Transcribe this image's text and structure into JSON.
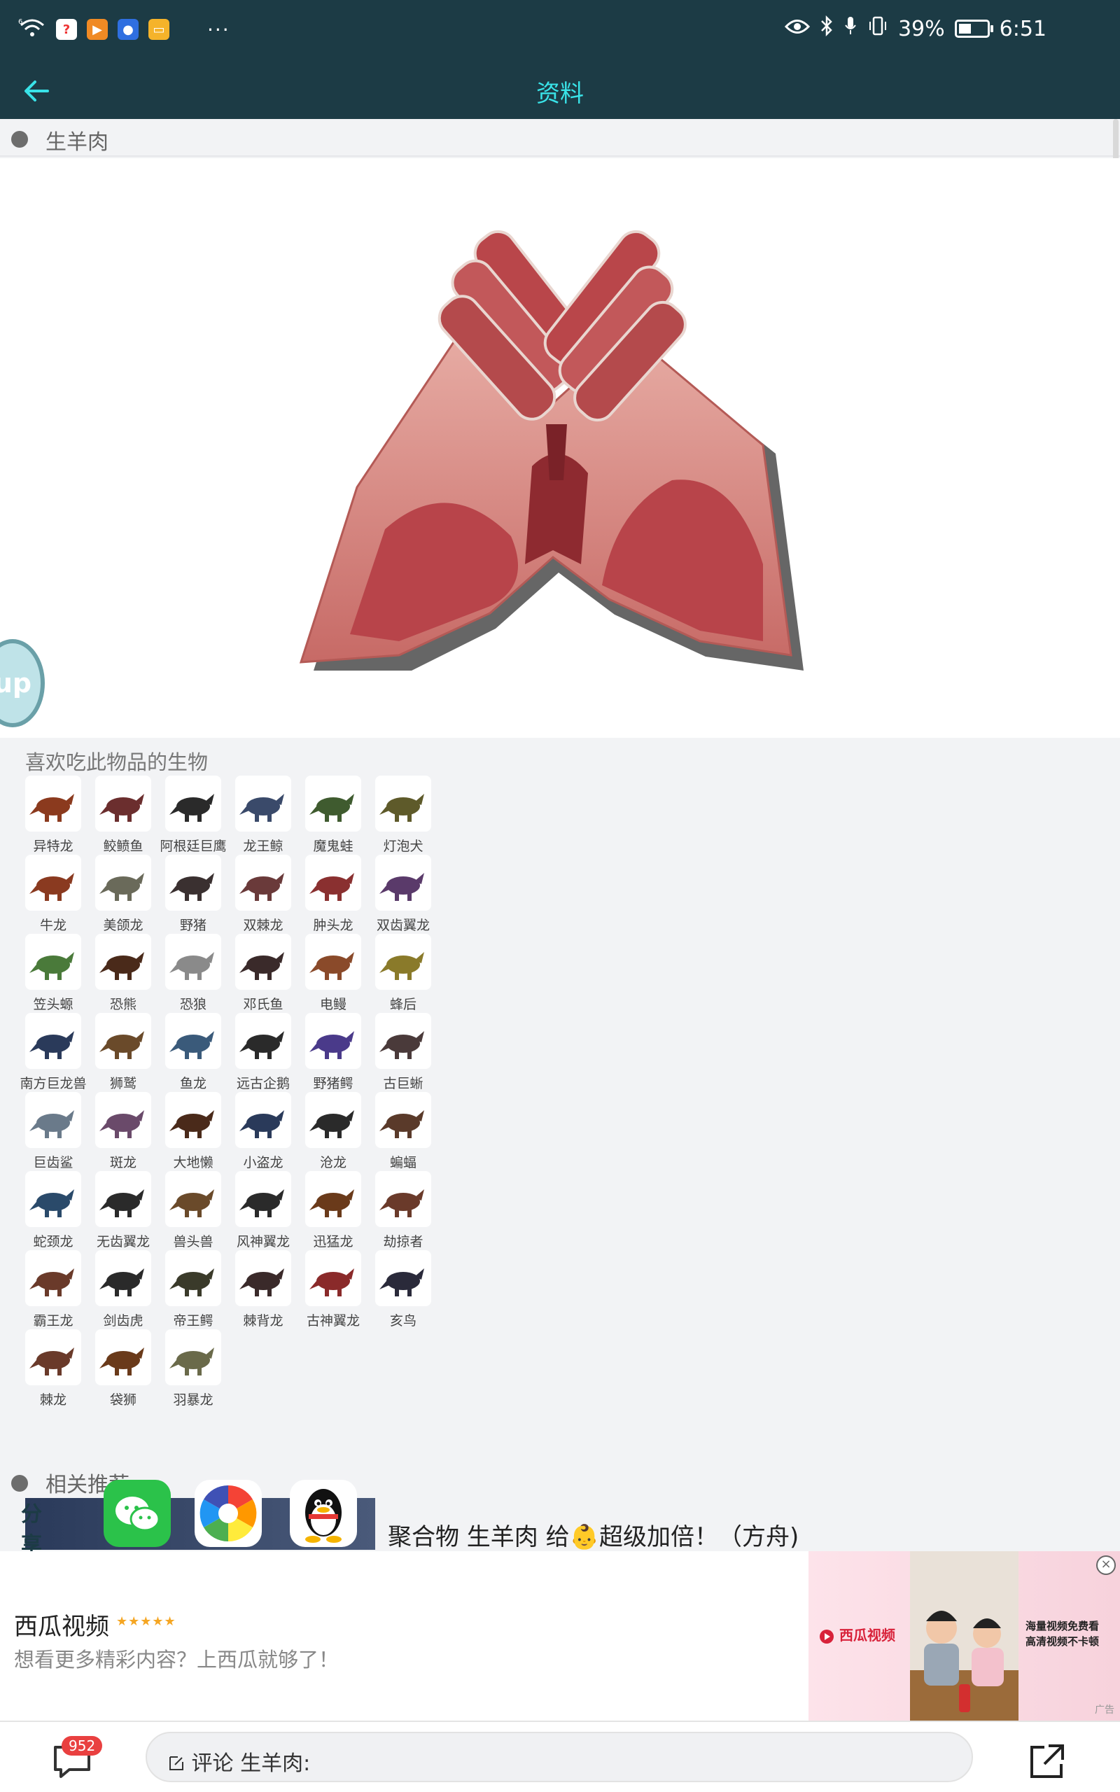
{
  "status_bar": {
    "signal": "6",
    "percent": "39%",
    "time": "6:51",
    "battery_level": 0.39,
    "more": "···"
  },
  "header": {
    "title": "资料"
  },
  "item": {
    "name": "生羊肉"
  },
  "up_bubble": "up",
  "creatures": {
    "title": "喜欢吃此物品的生物",
    "items": [
      {
        "name": "异特龙",
        "color": "#8b3a1e"
      },
      {
        "name": "鲛鲼鱼",
        "color": "#6b2e2e"
      },
      {
        "name": "阿根廷巨鹰",
        "color": "#2a2a2a"
      },
      {
        "name": "龙王鲸",
        "color": "#3a4a6a"
      },
      {
        "name": "魔鬼蛙",
        "color": "#3f5b2f"
      },
      {
        "name": "灯泡犬",
        "color": "#5e5a2a"
      },
      {
        "name": "牛龙",
        "color": "#8a3a20"
      },
      {
        "name": "美颌龙",
        "color": "#6a6a5a"
      },
      {
        "name": "野猪",
        "color": "#3a3030"
      },
      {
        "name": "双棘龙",
        "color": "#6a3a3a"
      },
      {
        "name": "肿头龙",
        "color": "#8a3030"
      },
      {
        "name": "双齿翼龙",
        "color": "#5a3a6a"
      },
      {
        "name": "笠头螈",
        "color": "#4a7a3a"
      },
      {
        "name": "恐熊",
        "color": "#4a2a1a"
      },
      {
        "name": "恐狼",
        "color": "#8a8a8a"
      },
      {
        "name": "邓氏鱼",
        "color": "#3a2a2a"
      },
      {
        "name": "电鳗",
        "color": "#8a4a2a"
      },
      {
        "name": "蜂后",
        "color": "#8a7a2a"
      },
      {
        "name": "南方巨龙兽",
        "color": "#2a3a5a"
      },
      {
        "name": "狮鹫",
        "color": "#6a4a2a"
      },
      {
        "name": "鱼龙",
        "color": "#3a5a7a"
      },
      {
        "name": "远古企鹅",
        "color": "#2a2a2a"
      },
      {
        "name": "野猪鳄",
        "color": "#4a3a8a"
      },
      {
        "name": "古巨蜥",
        "color": "#4a3a3a"
      },
      {
        "name": "巨齿鲨",
        "color": "#6a7a8a"
      },
      {
        "name": "斑龙",
        "color": "#6a4a6a"
      },
      {
        "name": "大地懒",
        "color": "#4a2a1a"
      },
      {
        "name": "小盗龙",
        "color": "#2a3a5a"
      },
      {
        "name": "沧龙",
        "color": "#2a2a2a"
      },
      {
        "name": "蝙蝠",
        "color": "#5a3a2a"
      },
      {
        "name": "蛇颈龙",
        "color": "#2a4a6a"
      },
      {
        "name": "无齿翼龙",
        "color": "#2a2a2a"
      },
      {
        "name": "兽头兽",
        "color": "#6a4a2a"
      },
      {
        "name": "风神翼龙",
        "color": "#2a2a2a"
      },
      {
        "name": "迅猛龙",
        "color": "#6a3a1a"
      },
      {
        "name": "劫掠者",
        "color": "#6a3a2a"
      },
      {
        "name": "霸王龙",
        "color": "#6a3a2a"
      },
      {
        "name": "剑齿虎",
        "color": "#2a2a2a"
      },
      {
        "name": "帝王鳄",
        "color": "#3a3a2a"
      },
      {
        "name": "棘背龙",
        "color": "#3a2a2a"
      },
      {
        "name": "古神翼龙",
        "color": "#8a2a2a"
      },
      {
        "name": "亥鸟",
        "color": "#2a2a3a"
      },
      {
        "name": "棘龙",
        "color": "#6a3a2a"
      },
      {
        "name": "袋狮",
        "color": "#6a3a1a"
      },
      {
        "name": "羽暴龙",
        "color": "#6a6a4a"
      }
    ]
  },
  "related": {
    "label": "相关推荐",
    "share_label": "分享到",
    "news_title": "聚合物 生羊肉 给👶超级加倍！（方舟)"
  },
  "ad": {
    "name": "西瓜视频",
    "stars": "★★★★★",
    "description": "想看更多精彩内容？上西瓜就够了！",
    "brand": "西瓜视频",
    "promo_line1": "海量视频免费看",
    "promo_line2": "高清视频不卡顿",
    "tag": "广告",
    "close": "×"
  },
  "bottom": {
    "comment_count": "952",
    "comment_placeholder": "评论 生羊肉:"
  },
  "colors": {
    "header_bg": "#1c3b45",
    "title_accent": "#39e3e8",
    "badge_red": "#e94040"
  }
}
